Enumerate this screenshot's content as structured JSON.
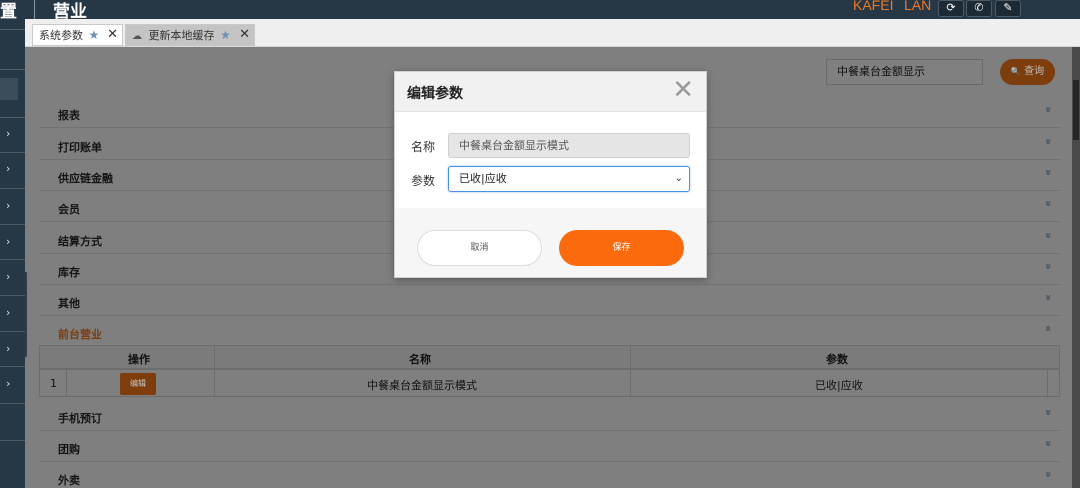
{
  "topbar": {
    "left_title": "置",
    "section_title": "营业",
    "user": "KAFEI",
    "network": "LAN",
    "buttons": [
      {
        "icon": "refresh-icon",
        "glyph": "⟳"
      },
      {
        "icon": "phone-icon",
        "glyph": "✆"
      },
      {
        "icon": "edit-icon",
        "glyph": "✎"
      }
    ]
  },
  "sidebar": {
    "chevron_glyph": "›",
    "collapse_glyph": "‹"
  },
  "tabs": [
    {
      "label": "系统参数",
      "active": true,
      "star": "★",
      "close": "✕"
    },
    {
      "label": "更新本地缓存",
      "active": false,
      "icon": "☁",
      "star": "★",
      "close": "✕"
    }
  ],
  "search": {
    "value": "中餐桌台金额显示",
    "button_label": "查询",
    "button_icon": "🔍"
  },
  "groups": [
    {
      "label": "报表"
    },
    {
      "label": "打印账单"
    },
    {
      "label": "供应链金融"
    },
    {
      "label": "会员"
    },
    {
      "label": "结算方式"
    },
    {
      "label": "库存"
    },
    {
      "label": "其他"
    },
    {
      "label": "前台营业",
      "open": true
    },
    {
      "label": "手机预订"
    },
    {
      "label": "团购"
    },
    {
      "label": "外卖"
    }
  ],
  "expand_glyph": "»",
  "collapse_group_glyph": "«",
  "table": {
    "headers": {
      "action": "操作",
      "name": "名称",
      "param": "参数"
    },
    "rows": [
      {
        "index": "1",
        "edit_label": "编辑",
        "name": "中餐桌台金额显示模式",
        "param": "已收|应收"
      }
    ]
  },
  "modal": {
    "title": "编辑参数",
    "close_glyph": "✕",
    "name_label": "名称",
    "name_value": "中餐桌台金额显示模式",
    "param_label": "参数",
    "param_value": "已收|应收",
    "select_arrow": "⌄",
    "cancel_label": "取消",
    "save_label": "保存"
  },
  "colors": {
    "accent": "#fb6b0e",
    "header_bg": "#263746"
  }
}
